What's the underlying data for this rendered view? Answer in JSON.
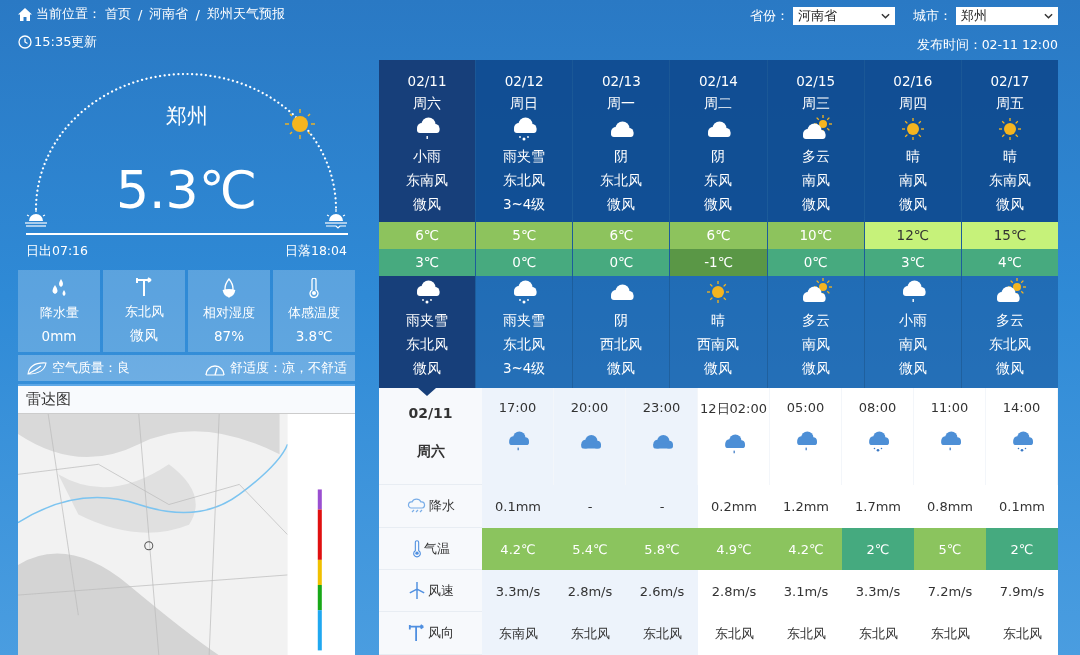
{
  "breadcrumb": {
    "label": "当前位置：",
    "separator": "/",
    "items": [
      "首页",
      "河南省",
      "郑州天气预报"
    ]
  },
  "selectors": [
    {
      "label": "省份：",
      "value": "河南省"
    },
    {
      "label": "城市：",
      "value": "郑州"
    }
  ],
  "updated": "15:35更新",
  "published": "发布时间：02-11 12:00",
  "current": {
    "city": "郑州",
    "temperature": "5.3℃",
    "sunrise": "日出07:16",
    "sunset": "日落18:04"
  },
  "metrics": [
    {
      "kind": "rain",
      "label": "降水量",
      "value": "0mm"
    },
    {
      "kind": "wind",
      "label": "东北风",
      "value": "微风"
    },
    {
      "kind": "humidity",
      "label": "相对湿度",
      "value": "87%"
    },
    {
      "kind": "feel",
      "label": "体感温度",
      "value": "3.8℃"
    }
  ],
  "air": {
    "quality": "空气质量：良",
    "comfort": "舒适度：凉，不舒适"
  },
  "radar": {
    "title": "雷达图"
  },
  "days": [
    {
      "date": "02/11",
      "weekday": "周六",
      "selected": true,
      "day": {
        "kind": "rain",
        "weather": "小雨",
        "wind_dir": "东南风",
        "wind_level": "微风"
      },
      "high": {
        "text": "6℃",
        "color": "#8dc35d"
      },
      "low": {
        "text": "3℃",
        "color": "#47aa7f"
      },
      "night": {
        "kind": "sleet",
        "weather": "雨夹雪",
        "wind_dir": "东北风",
        "wind_level": "微风"
      }
    },
    {
      "date": "02/12",
      "weekday": "周日",
      "selected": false,
      "day": {
        "kind": "sleet",
        "weather": "雨夹雪",
        "wind_dir": "东北风",
        "wind_level": "3~4级"
      },
      "high": {
        "text": "5℃",
        "color": "#8dc35d"
      },
      "low": {
        "text": "0℃",
        "color": "#47aa7f"
      },
      "night": {
        "kind": "sleet",
        "weather": "雨夹雪",
        "wind_dir": "东北风",
        "wind_level": "3~4级"
      }
    },
    {
      "date": "02/13",
      "weekday": "周一",
      "selected": false,
      "day": {
        "kind": "cloud",
        "weather": "阴",
        "wind_dir": "东北风",
        "wind_level": "微风"
      },
      "high": {
        "text": "6℃",
        "color": "#8dc35d"
      },
      "low": {
        "text": "0℃",
        "color": "#47aa7f"
      },
      "night": {
        "kind": "cloud",
        "weather": "阴",
        "wind_dir": "西北风",
        "wind_level": "微风"
      }
    },
    {
      "date": "02/14",
      "weekday": "周二",
      "selected": false,
      "day": {
        "kind": "cloud",
        "weather": "阴",
        "wind_dir": "东风",
        "wind_level": "微风"
      },
      "high": {
        "text": "6℃",
        "color": "#8dc35d"
      },
      "low": {
        "text": "-1℃",
        "color": "#5a9746"
      },
      "night": {
        "kind": "sun",
        "weather": "晴",
        "wind_dir": "西南风",
        "wind_level": "微风"
      }
    },
    {
      "date": "02/15",
      "weekday": "周三",
      "selected": false,
      "day": {
        "kind": "partly",
        "weather": "多云",
        "wind_dir": "南风",
        "wind_level": "微风"
      },
      "high": {
        "text": "10℃",
        "color": "#8dc35d"
      },
      "low": {
        "text": "0℃",
        "color": "#47aa7f"
      },
      "night": {
        "kind": "partly",
        "weather": "多云",
        "wind_dir": "南风",
        "wind_level": "微风"
      }
    },
    {
      "date": "02/16",
      "weekday": "周四",
      "selected": false,
      "day": {
        "kind": "sun",
        "weather": "晴",
        "wind_dir": "南风",
        "wind_level": "微风"
      },
      "high": {
        "text": "12℃",
        "color": "#c6f27a"
      },
      "low": {
        "text": "3℃",
        "color": "#47aa7f"
      },
      "night": {
        "kind": "rain",
        "weather": "小雨",
        "wind_dir": "南风",
        "wind_level": "微风"
      }
    },
    {
      "date": "02/17",
      "weekday": "周五",
      "selected": false,
      "day": {
        "kind": "sun",
        "weather": "晴",
        "wind_dir": "东南风",
        "wind_level": "微风"
      },
      "high": {
        "text": "15℃",
        "color": "#c6f27a"
      },
      "low": {
        "text": "4℃",
        "color": "#47aa7f"
      },
      "night": {
        "kind": "partly",
        "weather": "多云",
        "wind_dir": "东北风",
        "wind_level": "微风"
      }
    }
  ],
  "hourly": {
    "date": "02/11",
    "weekday": "周六",
    "row_labels": [
      {
        "kind": "precipitation",
        "label": "降水"
      },
      {
        "kind": "temperature",
        "label": "气温"
      },
      {
        "kind": "wind_speed",
        "label": "风速"
      },
      {
        "kind": "wind_direction",
        "label": "风向"
      }
    ],
    "slots": [
      {
        "time": "17:00",
        "current_day": true,
        "kind": "rain",
        "rain": "0.1mm",
        "temp": {
          "text": "4.2℃",
          "color": "#8bc45e"
        },
        "speed": "3.3m/s",
        "direction": "东南风"
      },
      {
        "time": "20:00",
        "current_day": true,
        "kind": "cloud",
        "rain": "-",
        "temp": {
          "text": "5.4℃",
          "color": "#8bc45e"
        },
        "speed": "2.8m/s",
        "direction": "东北风"
      },
      {
        "time": "23:00",
        "current_day": true,
        "kind": "cloud",
        "rain": "-",
        "temp": {
          "text": "5.8℃",
          "color": "#8bc45e"
        },
        "speed": "2.6m/s",
        "direction": "东北风"
      },
      {
        "time": "12日02:00",
        "current_day": false,
        "kind": "rain",
        "rain": "0.2mm",
        "temp": {
          "text": "4.9℃",
          "color": "#8bc45e"
        },
        "speed": "2.8m/s",
        "direction": "东北风"
      },
      {
        "time": "05:00",
        "current_day": false,
        "kind": "rain",
        "rain": "1.2mm",
        "temp": {
          "text": "4.2℃",
          "color": "#8bc45e"
        },
        "speed": "3.1m/s",
        "direction": "东北风"
      },
      {
        "time": "08:00",
        "current_day": false,
        "kind": "sleet",
        "rain": "1.7mm",
        "temp": {
          "text": "2℃",
          "color": "#45aa7f"
        },
        "speed": "3.3m/s",
        "direction": "东北风"
      },
      {
        "time": "11:00",
        "current_day": false,
        "kind": "rain",
        "rain": "0.8mm",
        "temp": {
          "text": "5℃",
          "color": "#8bc45e"
        },
        "speed": "7.2m/s",
        "direction": "东北风"
      },
      {
        "time": "14:00",
        "current_day": false,
        "kind": "sleet",
        "rain": "0.1mm",
        "temp": {
          "text": "2℃",
          "color": "#45aa7f"
        },
        "speed": "7.9m/s",
        "direction": "东北风"
      }
    ]
  }
}
